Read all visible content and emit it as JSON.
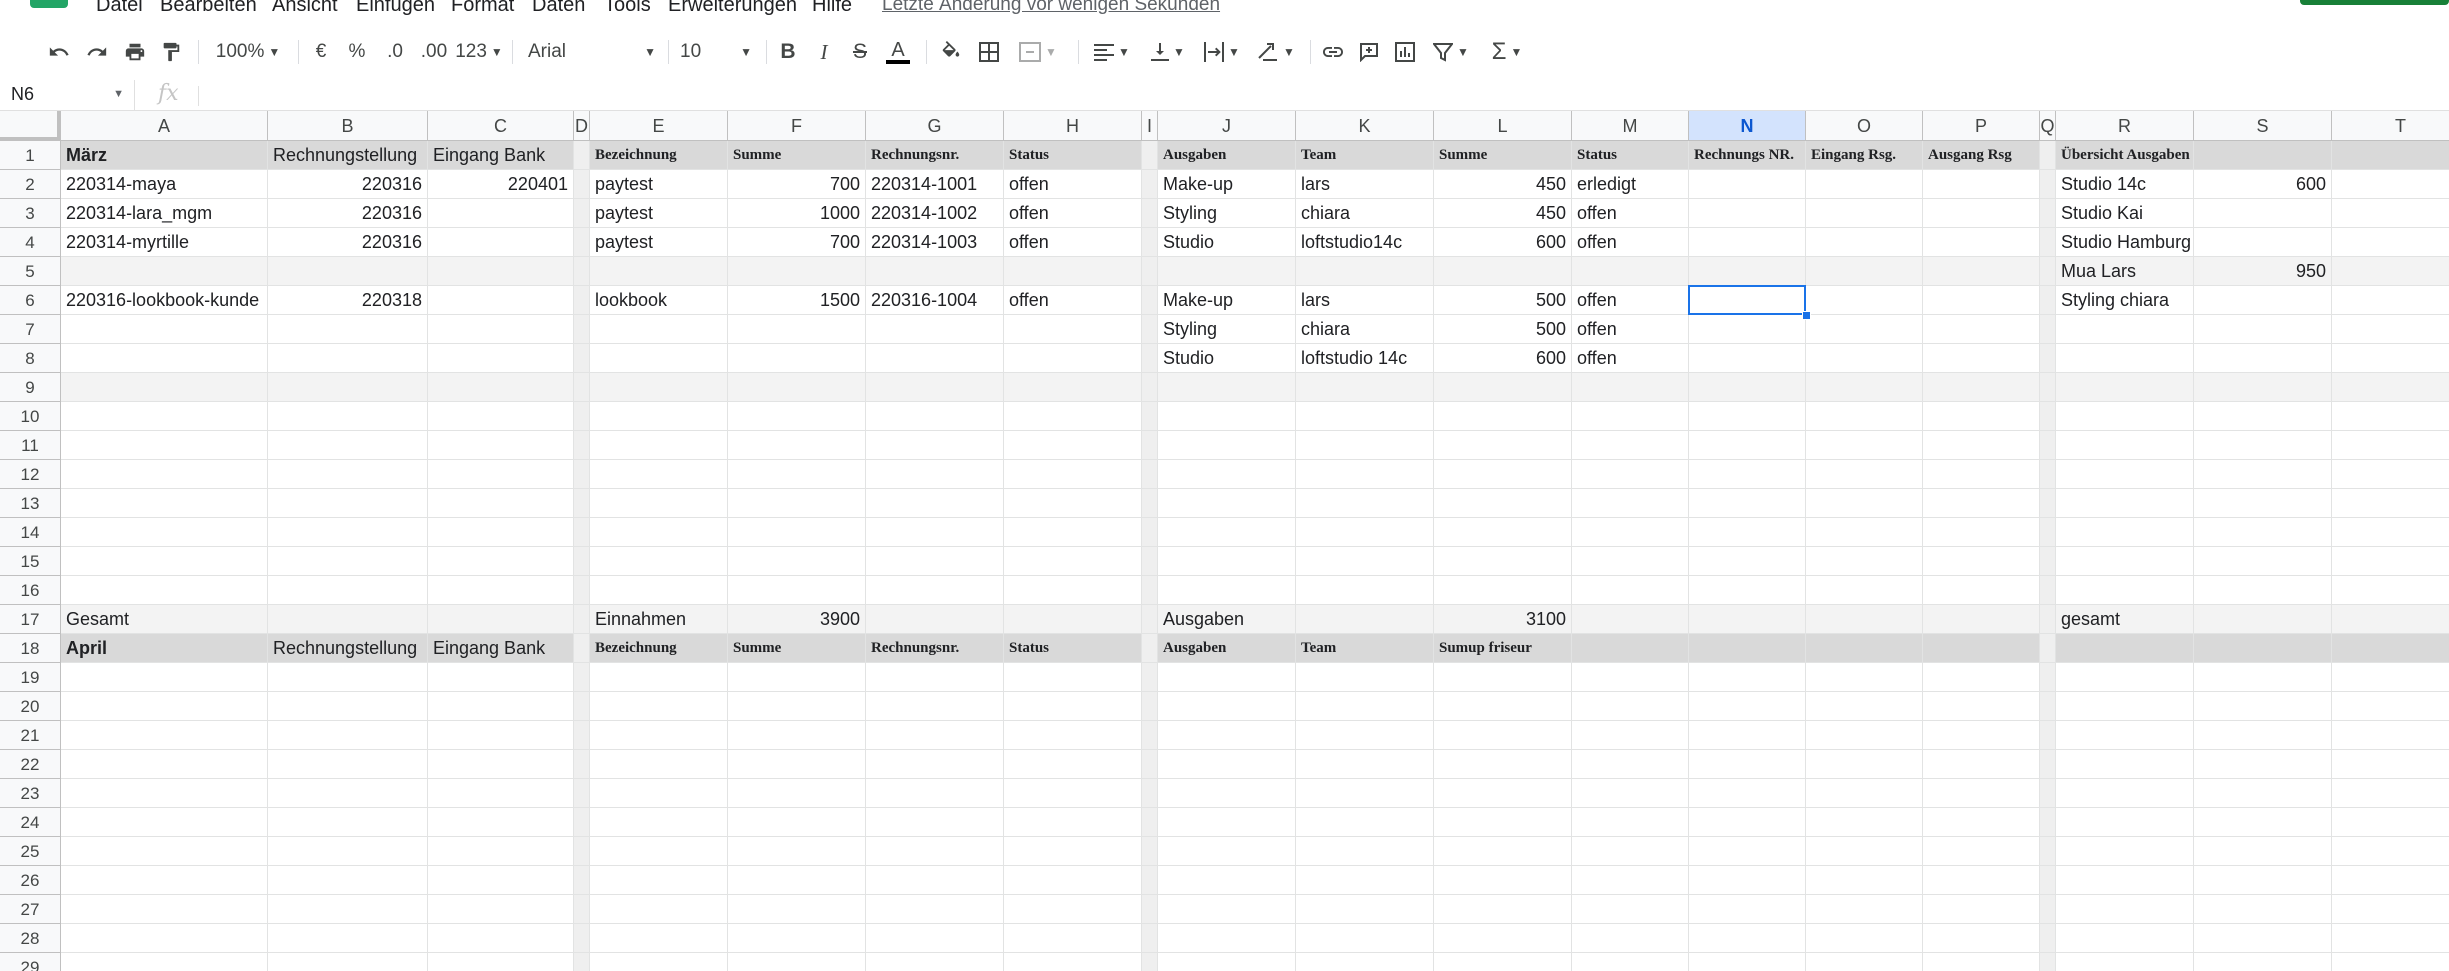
{
  "menu": {
    "items": [
      "Datei",
      "Bearbeiten",
      "Ansicht",
      "Einfügen",
      "Format",
      "Daten",
      "Tools",
      "Erweiterungen",
      "Hilfe"
    ],
    "last_edit": "Letzte Änderung vor wenigen Sekunden"
  },
  "toolbar": {
    "zoom": "100%",
    "currency": "€",
    "percent": "%",
    "decrease_decimals": ".0",
    "increase_decimals": ".00",
    "more_formats": "123",
    "font": "Arial",
    "font_size": "10"
  },
  "formula_bar": {
    "name_box": "N6",
    "fx": "fx"
  },
  "grid": {
    "columns": [
      "A",
      "B",
      "C",
      "D",
      "E",
      "F",
      "G",
      "H",
      "I",
      "J",
      "K",
      "L",
      "M",
      "N",
      "O",
      "P",
      "Q",
      "R",
      "S",
      "T"
    ],
    "selected_column": "N",
    "rows": [
      "1",
      "2",
      "3",
      "4",
      "5",
      "6",
      "7",
      "8",
      "9",
      "10",
      "11",
      "12",
      "13",
      "14",
      "15",
      "16",
      "17",
      "18",
      "19",
      "20",
      "21",
      "22",
      "23",
      "24",
      "25",
      "26",
      "27",
      "28",
      "29"
    ],
    "cells": {
      "A1": "März",
      "B1": "Rechnungstellung",
      "C1": "Eingang Bank",
      "E1": "Bezeichnung",
      "F1": "Summe",
      "G1": "Rechnungsnr.",
      "H1": "Status",
      "J1": "Ausgaben",
      "K1": "Team",
      "L1": "Summe",
      "M1": "Status",
      "N1": "Rechnungs NR.",
      "O1": "Eingang Rsg.",
      "P1": "Ausgang Rsg",
      "R1": "Übersicht Ausgaben (offen)",
      "A2": "220314-maya",
      "B2": "220316",
      "C2": "220401",
      "E2": "paytest",
      "F2": "700",
      "G2": "220314-1001",
      "H2": "offen",
      "J2": "Make-up",
      "K2": "lars",
      "L2": "450",
      "M2": "erledigt",
      "R2": "Studio 14c",
      "S2": "600",
      "A3": "220314-lara_mgm",
      "B3": "220316",
      "E3": "paytest",
      "F3": "1000",
      "G3": "220314-1002",
      "H3": "offen",
      "J3": "Styling",
      "K3": "chiara",
      "L3": "450",
      "M3": "offen",
      "R3": "Studio Kai",
      "A4": "220314-myrtille",
      "B4": "220316",
      "E4": "paytest",
      "F4": "700",
      "G4": "220314-1003",
      "H4": "offen",
      "J4": "Studio",
      "K4": "loftstudio14c",
      "L4": "600",
      "M4": "offen",
      "R4": "Studio Hamburg",
      "R5": "Mua Lars",
      "S5": "950",
      "A6": "220316-lookbook-kunde",
      "B6": "220318",
      "E6": "lookbook",
      "F6": "1500",
      "G6": "220316-1004",
      "H6": "offen",
      "J6": "Make-up",
      "K6": "lars",
      "L6": "500",
      "M6": "offen",
      "R6": "Styling chiara",
      "J7": "Styling",
      "K7": "chiara",
      "L7": "500",
      "M7": "offen",
      "J8": "Studio",
      "K8": "loftstudio 14c",
      "L8": "600",
      "M8": "offen",
      "A17": "Gesamt",
      "E17": "Einnahmen",
      "F17": "3900",
      "J17": "Ausgaben",
      "L17": "3100",
      "R17": "gesamt",
      "A18": "April",
      "B18": "Rechnungstellung",
      "C18": "Eingang Bank",
      "E18": "Bezeichnung",
      "F18": "Summe",
      "G18": "Rechnungsnr.",
      "H18": "Status",
      "J18": "Ausgaben",
      "K18": "Team",
      "L18": "Sumup friseur"
    }
  }
}
